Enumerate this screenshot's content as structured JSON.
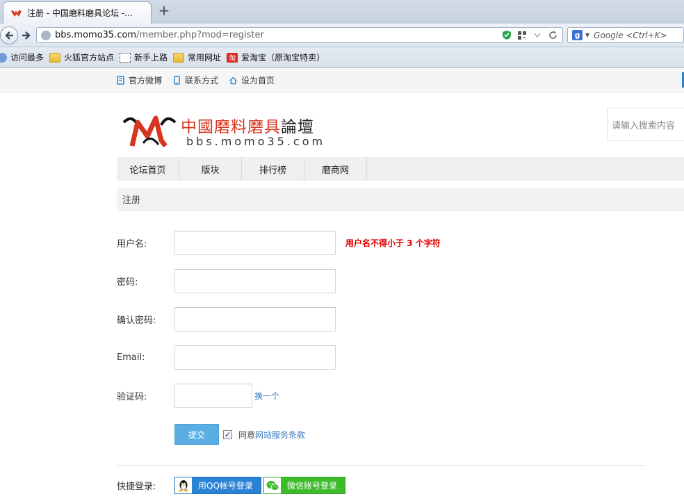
{
  "browser": {
    "tab_title": "注册 - 中国磨料磨具论坛 -...",
    "new_tab": "+",
    "url_host": "bbs.momo35.com",
    "url_path": "/member.php?mod=register",
    "url_prefix": "",
    "search_placeholder": "Google <Ctrl+K>",
    "bookmarks": [
      "访问最多",
      "火狐官方站点",
      "新手上路",
      "常用网址",
      "爱淘宝（原淘宝特卖）"
    ]
  },
  "topbar": {
    "links": [
      "官方微博",
      "联系方式",
      "设为首页"
    ]
  },
  "logo": {
    "cn_red": "中國磨料磨具",
    "cn_dark": "論壇",
    "domain": "bbs.momo35.com"
  },
  "search": {
    "placeholder": "请输入搜索内容"
  },
  "nav": {
    "items": [
      "论坛首页",
      "版块",
      "排行榜",
      "磨商网"
    ]
  },
  "section": {
    "title": "注册"
  },
  "form": {
    "username_label": "用户名:",
    "username_hint": "用户名不得小于 3 个字符",
    "password_label": "密码:",
    "confirm_label": "确认密码:",
    "email_label": "Email:",
    "captcha_label": "验证码:",
    "captcha_refresh": "换一个",
    "submit_label": "提交",
    "agree_prefix": "同意",
    "agree_link": "网站服务条款",
    "agree_checked": true
  },
  "quick_login": {
    "label": "快捷登录:",
    "qq_label": "用QQ帐号登录",
    "wechat_label": "微信账号登录"
  },
  "colors": {
    "accent_blue": "#2a86d0",
    "error_red": "#dd0000",
    "qq_blue": "#2a82d4",
    "wechat_green": "#3dbb2b",
    "submit_blue": "#5aaee4"
  }
}
